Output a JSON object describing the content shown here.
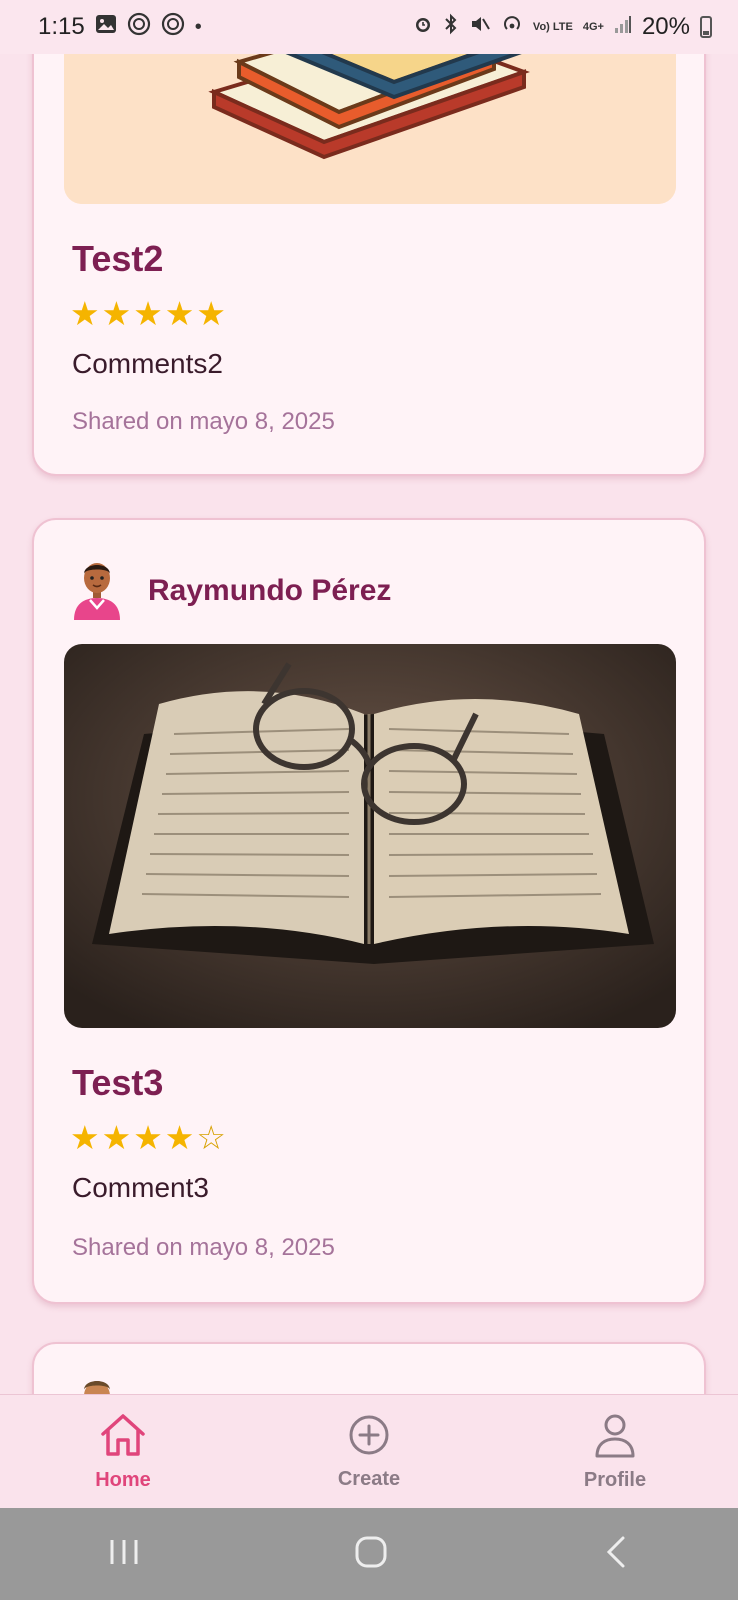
{
  "status": {
    "time": "1:15",
    "network": "4G+",
    "volte": "Vo) LTE",
    "battery": "20%"
  },
  "posts": [
    {
      "title": "Test2",
      "rating": 5,
      "comment": "Comments2",
      "shared": "Shared on mayo 8, 2025"
    },
    {
      "author": "Raymundo Pérez",
      "title": "Test3",
      "rating": 4,
      "comment": "Comment3",
      "shared": "Shared on mayo 8, 2025"
    }
  ],
  "nav": {
    "home": "Home",
    "create": "Create",
    "profile": "Profile"
  },
  "colors": {
    "accent": "#e0457b",
    "title": "#7d1f52",
    "star": "#f5b400"
  }
}
